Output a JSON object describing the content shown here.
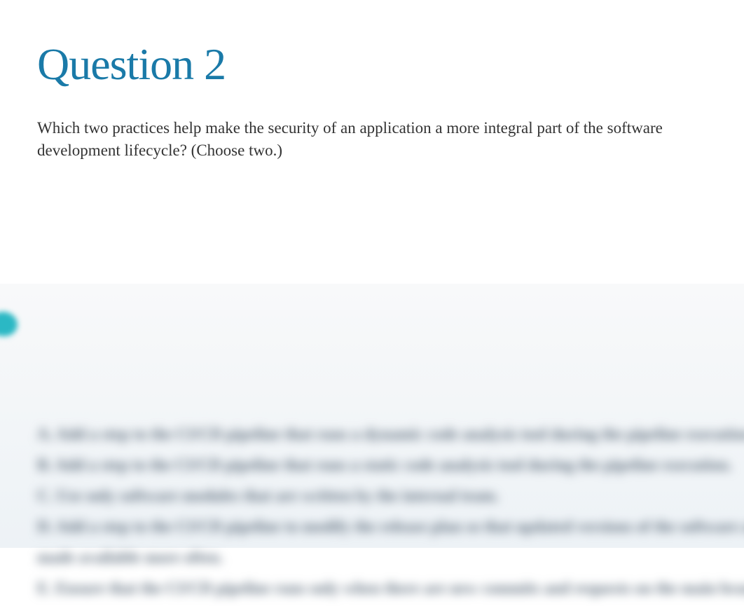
{
  "question": {
    "title": "Question 2",
    "text": "Which two practices help make the security of an application a more integral part of the software development lifecycle? (Choose two.)"
  },
  "options": {
    "a": "A. Add a step to the CI/CD pipeline that runs a dynamic code analysis tool during the pipeline execution.",
    "b": "B. Add a step to the CI/CD pipeline that runs a static code analysis tool during the pipeline execution.",
    "c": "C. Use only software modules that are written by the internal team.",
    "d": "D. Add a step to the CI/CD pipeline to modify the release plan so that updated versions of the software are",
    "d_cont": "made available more often.",
    "e": "E. Ensure that the CI/CD pipeline runs only when there are new commits and requests on the main branch."
  }
}
